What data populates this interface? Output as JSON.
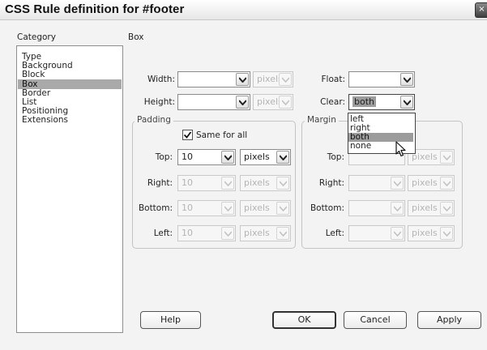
{
  "window": {
    "title": "CSS Rule definition for #footer",
    "close_glyph": "×"
  },
  "category": {
    "header": "Category",
    "items": [
      "Type",
      "Background",
      "Block",
      "Box",
      "Border",
      "List",
      "Positioning",
      "Extensions"
    ],
    "selected": "Box"
  },
  "panel": {
    "header": "Box"
  },
  "box": {
    "width": {
      "label": "Width:",
      "value": "",
      "unit": "pixels"
    },
    "height": {
      "label": "Height:",
      "value": "",
      "unit": "pixels"
    },
    "float": {
      "label": "Float:",
      "value": ""
    },
    "clear": {
      "label": "Clear:",
      "value": "both",
      "options": [
        "left",
        "right",
        "both",
        "none"
      ],
      "highlighted": "both"
    }
  },
  "padding": {
    "legend": "Padding",
    "same_for_all": {
      "label": "Same for all",
      "checked": true
    },
    "top": {
      "label": "Top:",
      "value": "10",
      "unit": "pixels"
    },
    "right": {
      "label": "Right:",
      "value": "10",
      "unit": "pixels"
    },
    "bottom": {
      "label": "Bottom:",
      "value": "10",
      "unit": "pixels"
    },
    "left": {
      "label": "Left:",
      "value": "10",
      "unit": "pixels"
    }
  },
  "margin": {
    "legend": "Margin",
    "top": {
      "label": "Top:",
      "value": "",
      "unit": "pixels"
    },
    "right": {
      "label": "Right:",
      "value": "",
      "unit": "pixels"
    },
    "bottom": {
      "label": "Bottom:",
      "value": "",
      "unit": "pixels"
    },
    "left": {
      "label": "Left:",
      "value": "",
      "unit": "pixels"
    }
  },
  "buttons": {
    "help": "Help",
    "ok": "OK",
    "cancel": "Cancel",
    "apply": "Apply"
  },
  "colors": {
    "selection": "#a9a9a9",
    "dropdown_highlight": "#9c9c9c",
    "background": "#f3f3f3"
  }
}
